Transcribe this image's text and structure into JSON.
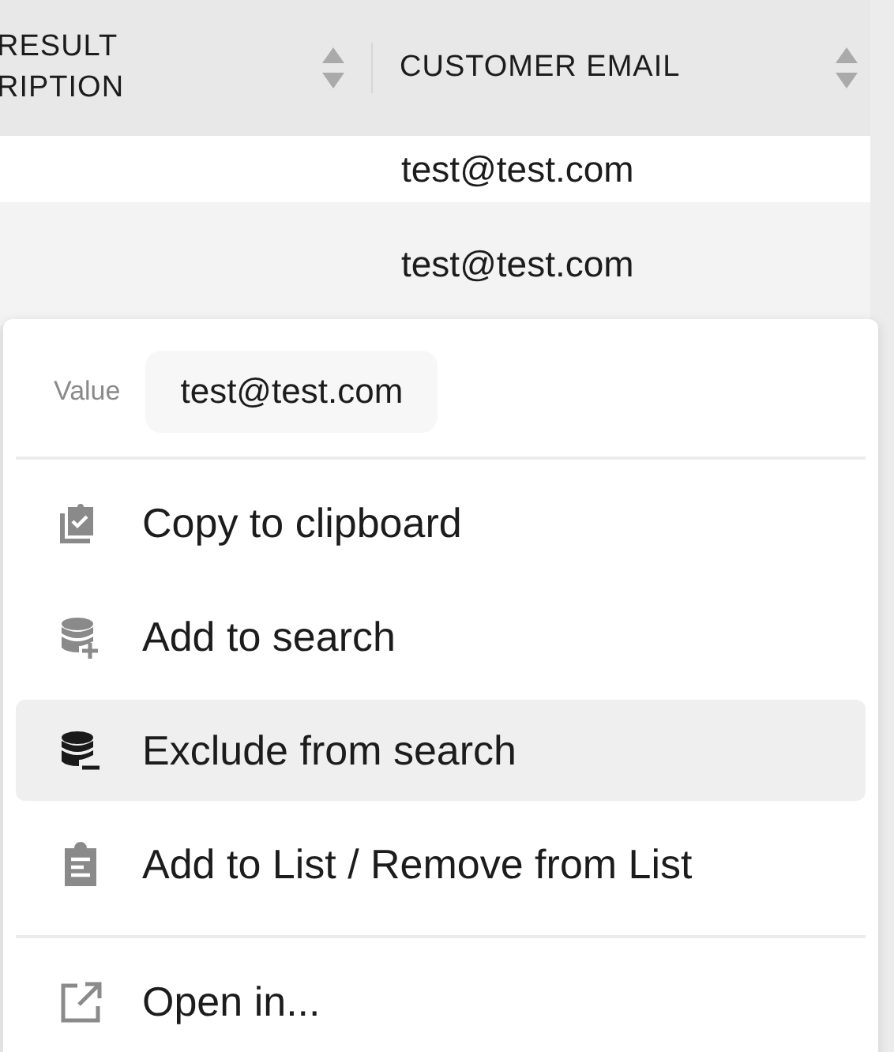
{
  "table": {
    "columns": [
      {
        "label": "RESULT\nRIPTION"
      },
      {
        "label": "CUSTOMER EMAIL"
      }
    ],
    "rows": [
      {
        "customer_email": "test@test.com"
      },
      {
        "customer_email": "test@test.com"
      }
    ]
  },
  "context_menu": {
    "value_label": "Value",
    "value": "test@test.com",
    "groups": [
      [
        {
          "kind": "clipboard-check",
          "label": "Copy to clipboard",
          "selected": false
        },
        {
          "kind": "database-plus",
          "label": "Add to search",
          "selected": false
        },
        {
          "kind": "database-minus",
          "label": "Exclude from search",
          "selected": true
        },
        {
          "kind": "clipboard-list",
          "label": "Add to List / Remove from List",
          "selected": false
        }
      ],
      [
        {
          "kind": "external-link",
          "label": "Open in...",
          "selected": false
        }
      ]
    ]
  }
}
